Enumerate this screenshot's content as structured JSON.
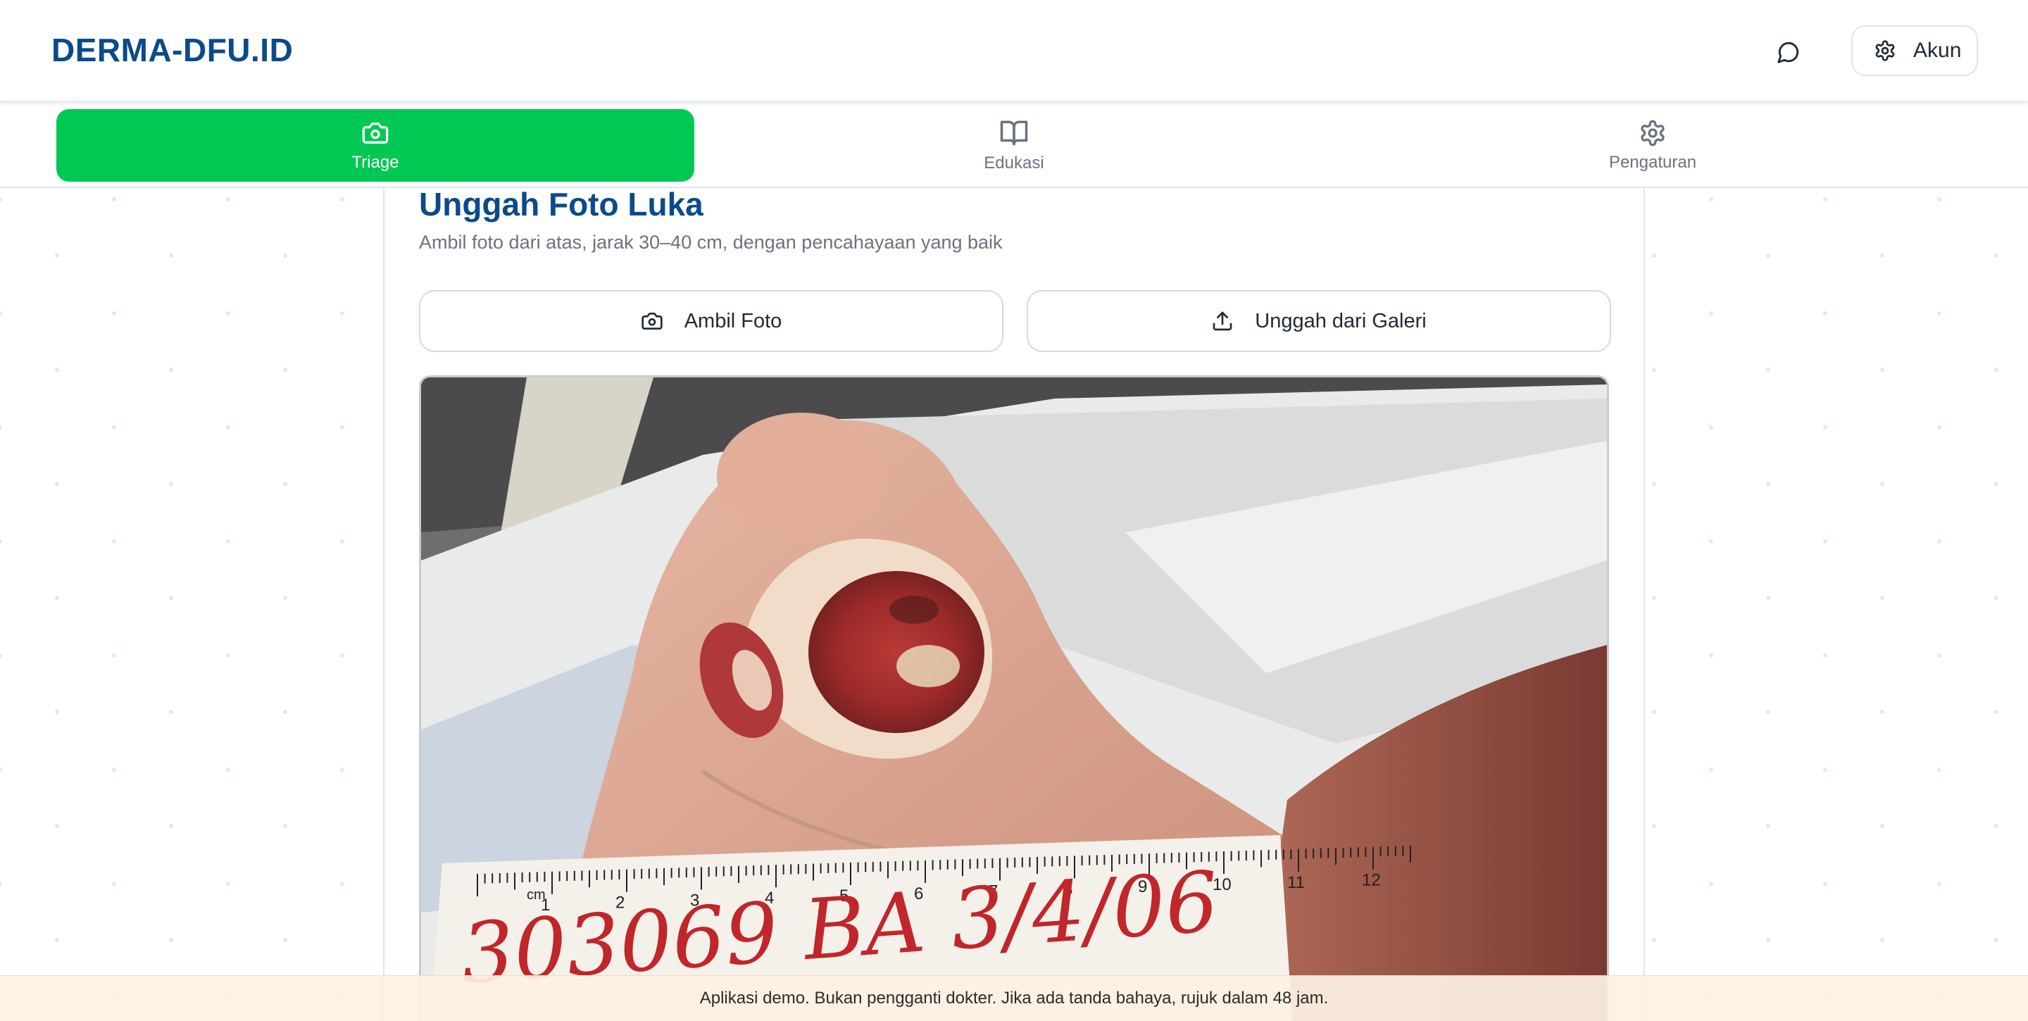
{
  "header": {
    "brand": "DERMA-DFU.ID",
    "chat_icon": "chat-bubble-icon",
    "account_label": "Akun",
    "account_icon": "gear-icon"
  },
  "tabs": [
    {
      "label": "Triage",
      "icon": "camera-icon",
      "active": true
    },
    {
      "label": "Edukasi",
      "icon": "open-book-icon",
      "active": false
    },
    {
      "label": "Pengaturan",
      "icon": "gear-icon",
      "active": false
    }
  ],
  "upload": {
    "title": "Unggah Foto Luka",
    "subtitle": "Ambil foto dari atas, jarak 30–40 cm, dengan pencahayaan yang baik",
    "take_photo_label": "Ambil Foto",
    "take_photo_icon": "camera-icon",
    "gallery_label": "Unggah dari Galeri",
    "gallery_icon": "upload-icon",
    "photo": {
      "ruler_unit": "cm",
      "ruler_numbers": [
        "1",
        "2",
        "3",
        "4",
        "5",
        "6",
        "7",
        "8",
        "9",
        "10",
        "11",
        "12"
      ],
      "handwriting": "303069 BA 3/4/06"
    }
  },
  "footer": {
    "disclaimer": "Aplikasi demo. Bukan pengganti dokter. Jika ada tanda bahaya, rujuk dalam 48 jam."
  },
  "colors": {
    "brand": "#0b4a8b",
    "active_tab": "#00c853",
    "disclaimer_bg": "#fdf1e2"
  }
}
